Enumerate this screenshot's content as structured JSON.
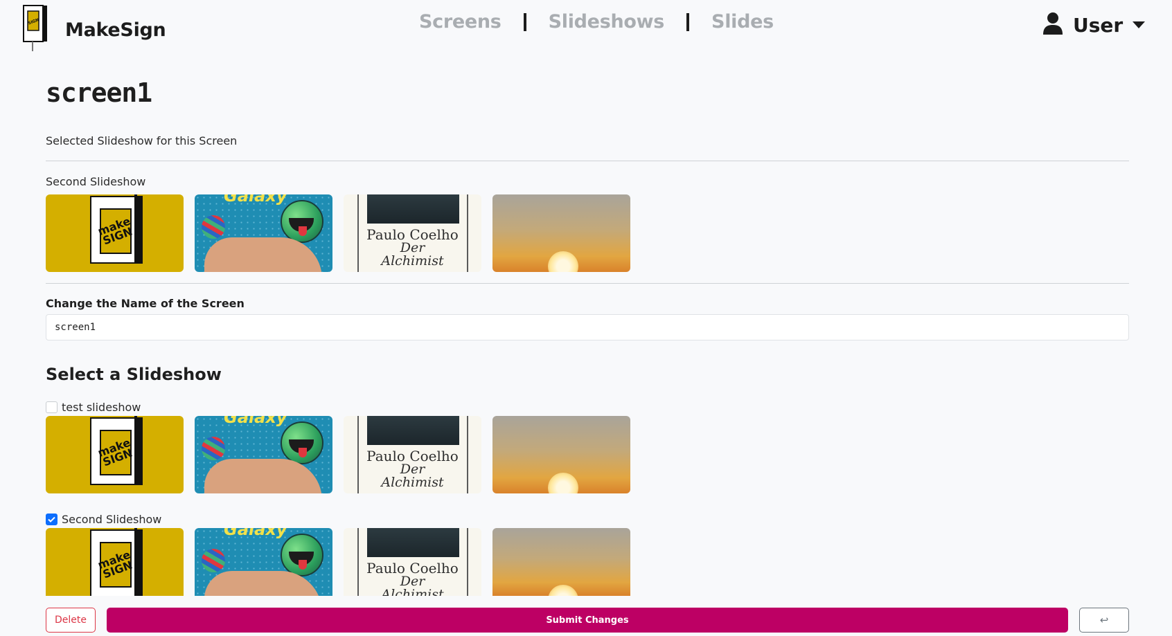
{
  "app": {
    "brand": "MakeSign",
    "logo_text": "make SIGN"
  },
  "nav": {
    "links": [
      "Screens",
      "Slideshows",
      "Slides"
    ],
    "user_label": "User"
  },
  "page": {
    "title": "screen1"
  },
  "current": {
    "label": "Selected Slideshow for this Screen",
    "slideshow_name": "Second Slideshow"
  },
  "slides": {
    "galaxy_word": "Galaxy",
    "book_author": "Paulo Coelho",
    "book_title_1": "Der",
    "book_title_2": "Alchimist"
  },
  "form": {
    "name_label": "Change the Name of the Screen",
    "name_value": "screen1",
    "select_title": "Select a Slideshow",
    "options": [
      {
        "label": "test slideshow",
        "checked": false
      },
      {
        "label": "Second Slideshow",
        "checked": true
      }
    ]
  },
  "actions": {
    "delete": "Delete",
    "submit": "Submit Changes",
    "back": "↩"
  },
  "colors": {
    "brand_yellow": "#d4af00",
    "submit": "#bd0064",
    "delete": "#dc3545",
    "checkbox": "#0d6efd"
  },
  "icons": {
    "user": "user-icon",
    "caret": "caret-down-icon",
    "back": "return-arrow-icon"
  }
}
